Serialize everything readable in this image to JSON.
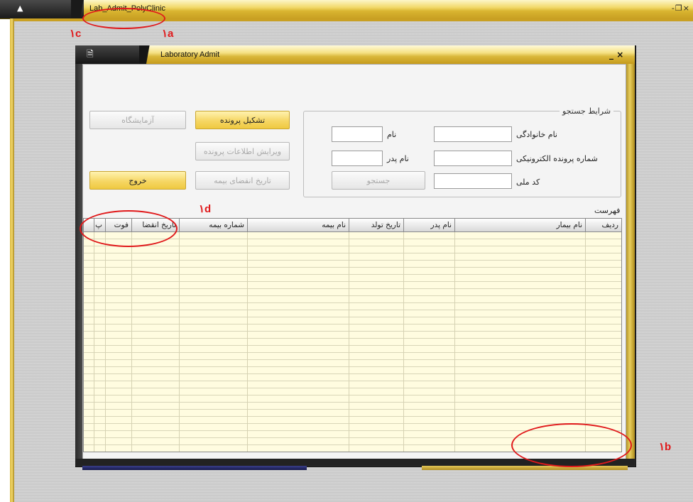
{
  "outer_window": {
    "title": "Lab_Admit_PolyClinic",
    "controls": "- ̲▫×"
  },
  "inner_window": {
    "title": "Laboratory Admit",
    "controls": "_ ×"
  },
  "buttons": {
    "create_file": "تشکیل پرونده",
    "laboratory": "آزمایشگاه",
    "edit_file": "ویرایش اطلاعات پرونده",
    "insurance_expiry": "تاریخ انقضای بیمه",
    "exit": "خروج",
    "search": "جستجو"
  },
  "search_group": {
    "legend": "شرایط جستجو",
    "last_name_label": "نام خانوادگی",
    "first_name_label": "نام",
    "ehr_label": "شماره پرونده الکترونیکی",
    "father_name_label": "نام پدر",
    "national_code_label": "کد ملی"
  },
  "list": {
    "label": "فهرست",
    "columns": [
      "ردیف",
      "نام بیمار",
      "نام پدر",
      "تاریخ تولد",
      "نام بیمه",
      "شماره بیمه",
      "تاریخ انقضا",
      "فوت",
      "پ"
    ]
  },
  "annotations": [
    "۱a",
    "۱b",
    "۱c",
    "۱d"
  ],
  "colors": {
    "accent_gold": "#f6d765",
    "grid_bg": "#fffce0",
    "annotation_red": "#e0191b"
  }
}
